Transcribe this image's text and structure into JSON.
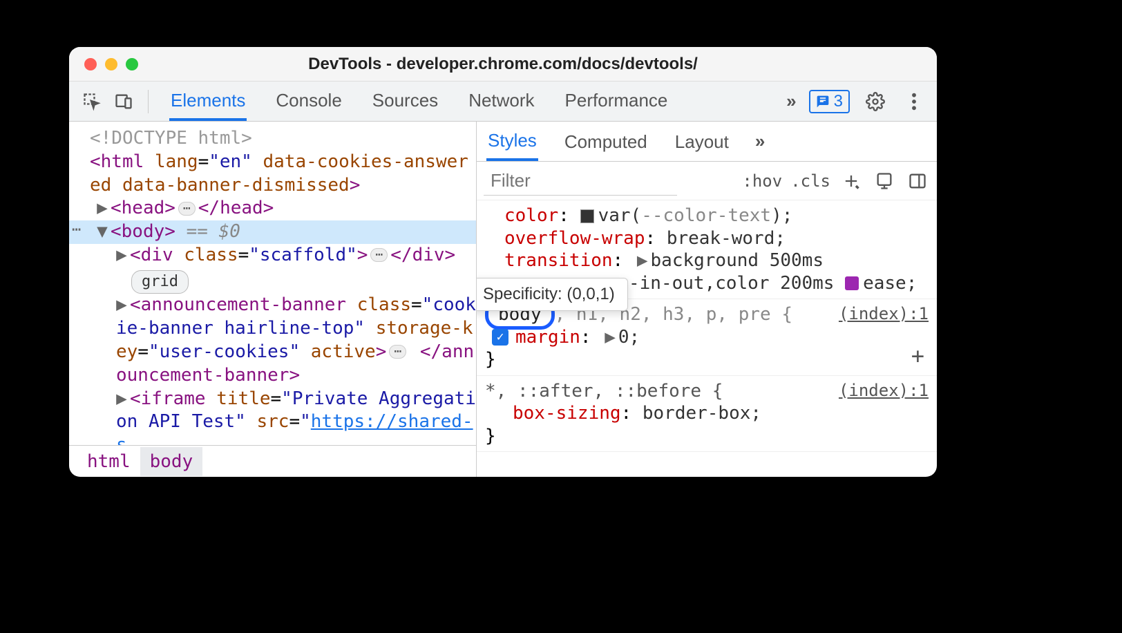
{
  "window_title": "DevTools - developer.chrome.com/docs/devtools/",
  "toolbar": {
    "tabs": [
      "Elements",
      "Console",
      "Sources",
      "Network",
      "Performance"
    ],
    "active_tab": 0,
    "issue_count": "3"
  },
  "dom": {
    "doctype": "<!DOCTYPE html>",
    "html_open": "<html lang=\"en\" data-cookies-answered data-banner-dismissed>",
    "head": {
      "open": "<head>",
      "close": "</head>"
    },
    "body_open": "<body>",
    "dollar0": " == $0",
    "div_scaffold": {
      "open": "<div class=\"scaffold\">",
      "close": "</div>"
    },
    "grid_badge": "grid",
    "announcement_banner": "<announcement-banner class=\"cookie-banner hairline-top\" storage-key=\"user-cookies\" active>",
    "announcement_close": "</announcement-banner>",
    "iframe_frag": "<iframe title=\"Private Aggregation API Test\" src=\"https://shared-s"
  },
  "breadcrumbs": [
    "html",
    "body"
  ],
  "styles": {
    "tabs": [
      "Styles",
      "Computed",
      "Layout"
    ],
    "active_tab": 0,
    "filter_placeholder": "Filter",
    "hov": ":hov",
    "cls": ".cls",
    "tooltip": "Specificity: (0,0,1)",
    "rule0": {
      "color_prop": "color",
      "color_val_var": "--color-text",
      "overflow_prop": "overflow-wrap",
      "overflow_val": "break-word",
      "trans_prop": "transition",
      "trans_v1": "background 500ms",
      "trans_v2": "-in-out,color 200ms",
      "trans_v3": "ease"
    },
    "rule1": {
      "selector_matched": "body",
      "selector_rest": ", h1, h2, h3, p, pre {",
      "src": "(index):1",
      "margin_prop": "margin",
      "margin_val": "0"
    },
    "rule2": {
      "selector": "*, ::after, ::before {",
      "src": "(index):1",
      "box_prop": "box-sizing",
      "box_val": "border-box"
    }
  }
}
